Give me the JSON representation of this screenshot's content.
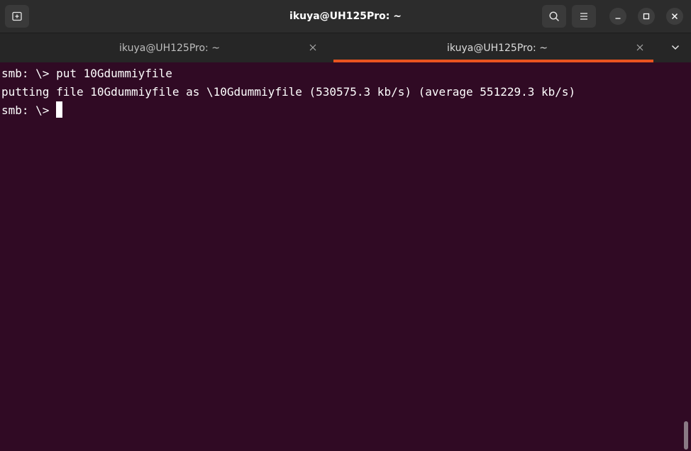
{
  "window": {
    "title": "ikuya@UH125Pro: ~"
  },
  "header": {
    "new_tab_icon": "new-tab-icon",
    "search_icon": "search-icon",
    "menu_icon": "hamburger-menu-icon",
    "minimize_icon": "minimize-icon",
    "maximize_icon": "maximize-icon",
    "close_icon": "close-icon"
  },
  "tabs": [
    {
      "label": "ikuya@UH125Pro: ~",
      "active": false
    },
    {
      "label": "ikuya@UH125Pro: ~",
      "active": true
    }
  ],
  "colors": {
    "terminal_bg": "#300a24",
    "accent": "#e95420",
    "headerbar_bg": "#2c2c2c",
    "text": "#ffffff"
  },
  "terminal": {
    "lines": [
      "smb: \\> put 10Gdummiyfile",
      "putting file 10Gdummiyfile as \\10Gdummiyfile (530575.3 kb/s) (average 551229.3 kb/s)",
      "smb: \\> "
    ]
  }
}
